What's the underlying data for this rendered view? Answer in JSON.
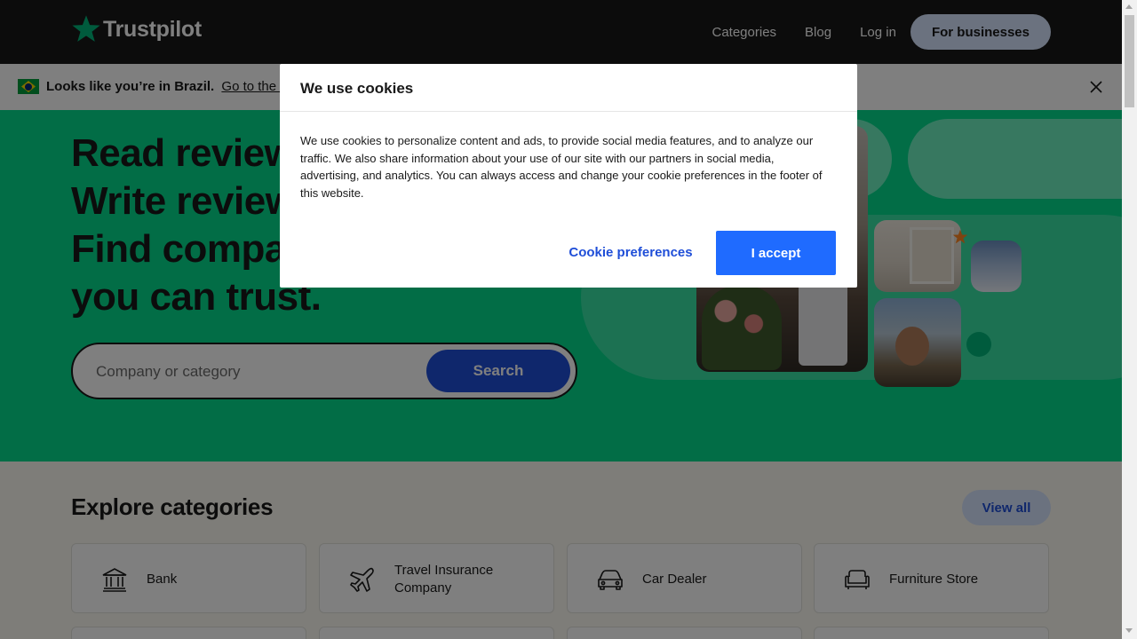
{
  "header": {
    "logo_text": "Trustpilot",
    "nav": [
      "Categories",
      "Blog",
      "Log in"
    ],
    "business_button": "For businesses"
  },
  "banner": {
    "text": "Looks like you’re in Brazil.",
    "link": "Go to the Br"
  },
  "hero": {
    "title_lines": [
      "Read review",
      "Write review",
      "Find compar",
      "you can trust."
    ],
    "search_placeholder": "Company or category",
    "search_button": "Search"
  },
  "categories": {
    "title": "Explore categories",
    "view_all": "View all",
    "items": [
      {
        "label": "Bank",
        "icon": "bank-icon"
      },
      {
        "label": "Travel Insurance\nCompany",
        "icon": "plane-icon"
      },
      {
        "label": "Car Dealer",
        "icon": "car-icon"
      },
      {
        "label": "Furniture Store",
        "icon": "sofa-icon"
      }
    ]
  },
  "cookie_modal": {
    "title": "We use cookies",
    "body": "We use cookies to personalize content and ads, to provide social media features, and to analyze our traffic. We also share information about your use of our site with our partners in social media, advertising, and analytics. You can always access and change your cookie preferences in the footer of this website.",
    "preferences_button": "Cookie preferences",
    "accept_button": "I accept"
  },
  "colors": {
    "header_bg": "#191919",
    "hero_bg": "#04da8d",
    "brand_star": "#00b67a",
    "primary_blue": "#1f6bff"
  }
}
